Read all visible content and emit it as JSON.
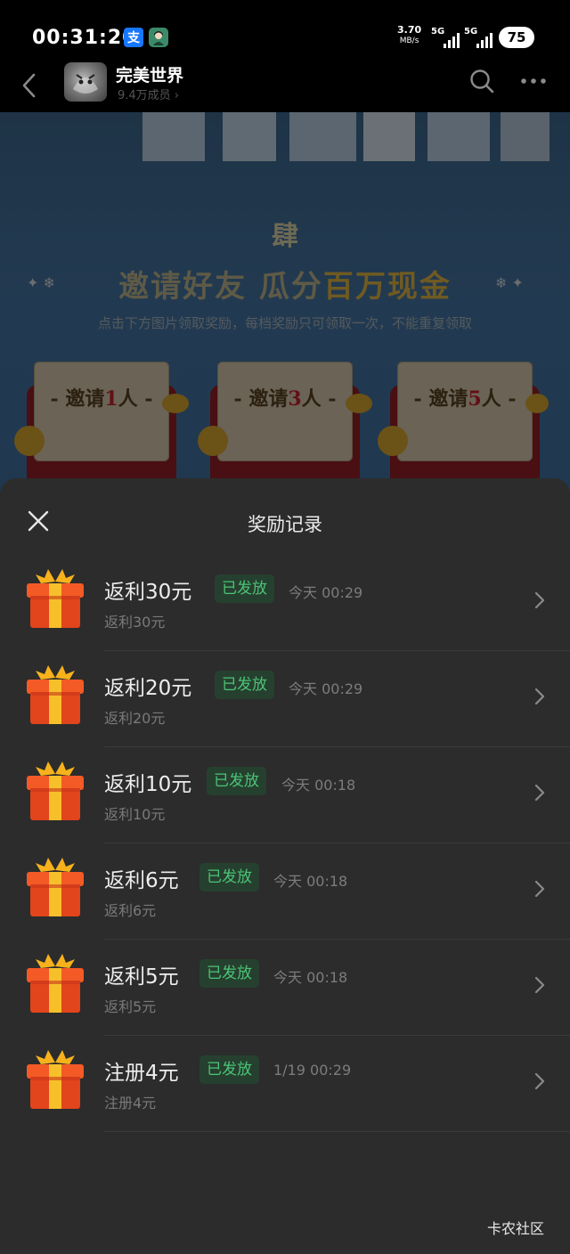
{
  "status_bar": {
    "time": "00:31:20",
    "badges": [
      {
        "icon": "alipay-icon",
        "glyph": "支"
      },
      {
        "icon": "avatar-icon",
        "glyph": ""
      }
    ],
    "net_speed": "3.70",
    "net_unit": "MB/s",
    "sim1_label": "5G",
    "sim2_label": "5G",
    "battery": "75"
  },
  "header": {
    "title": "完美世界",
    "members": "9.4万成员 ›"
  },
  "banner": {
    "logo_text": "肆",
    "title_main": "邀请好友 瓜分",
    "title_highlight": "百万现金",
    "subtitle": "点击下方图片领取奖励，每档奖励只可领取一次，不能重复领取",
    "cards": [
      {
        "prefix": "- 邀请",
        "num": "1",
        "suffix": "人 -"
      },
      {
        "prefix": "- 邀请",
        "num": "3",
        "suffix": "人 -"
      },
      {
        "prefix": "- 邀请",
        "num": "5",
        "suffix": "人 -"
      }
    ]
  },
  "sheet": {
    "title": "奖励记录",
    "status_color": "#4cc377",
    "records": [
      {
        "title": "返利30元",
        "status": "已发放",
        "time": "今天 00:29",
        "sub": "返利30元"
      },
      {
        "title": "返利20元",
        "status": "已发放",
        "time": "今天 00:29",
        "sub": "返利20元"
      },
      {
        "title": "返利10元",
        "status": "已发放",
        "time": "今天 00:18",
        "sub": "返利10元"
      },
      {
        "title": "返利6元",
        "status": "已发放",
        "time": "今天 00:18",
        "sub": "返利6元"
      },
      {
        "title": "返利5元",
        "status": "已发放",
        "time": "今天 00:18",
        "sub": "返利5元"
      },
      {
        "title": "注册4元",
        "status": "已发放",
        "time": "1/19 00:29",
        "sub": "注册4元"
      }
    ]
  },
  "watermark": "卡农社区"
}
